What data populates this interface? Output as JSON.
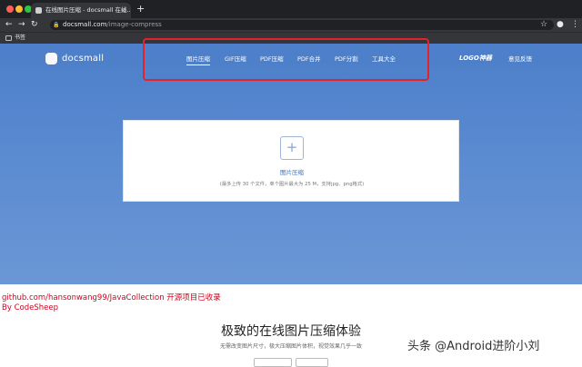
{
  "browser": {
    "tab_title": "在线图片压缩 - docsmall 在线...",
    "tab_close": "×",
    "new_tab": "+",
    "url_host": "docsmall.com",
    "url_path": "/image-compress",
    "bookmarks_label": "书签"
  },
  "site": {
    "logo": "docsmall",
    "nav": [
      "图片压缩",
      "GIF压缩",
      "PDF压缩",
      "PDF合并",
      "PDF分割",
      "工具大全"
    ],
    "logo_nav": "LOGO神器",
    "feedback": "意见反馈"
  },
  "upload": {
    "plus": "+",
    "label": "图片压缩",
    "hint": "(最多上传 30 个文件，单个图片最大为 25 M，支持jpg、png格式)"
  },
  "overlay": {
    "line1": "github.com/hansonwang99/JavaCollection 开源项目已收录",
    "line2": "By CodeSheep"
  },
  "content": {
    "title": "极致的在线图片压缩体验",
    "subtitle": "无需改变图片尺寸，极大压缩图片体积，视觉效果几乎一致",
    "btn1": "",
    "btn2": ""
  },
  "watermark": "头条 @Android进阶小刘",
  "colors": {
    "hero_top": "#4c7ec9",
    "hero_bottom": "#6b97d6",
    "highlight_box": "#e5212b",
    "overlay_text": "#d0021b"
  }
}
